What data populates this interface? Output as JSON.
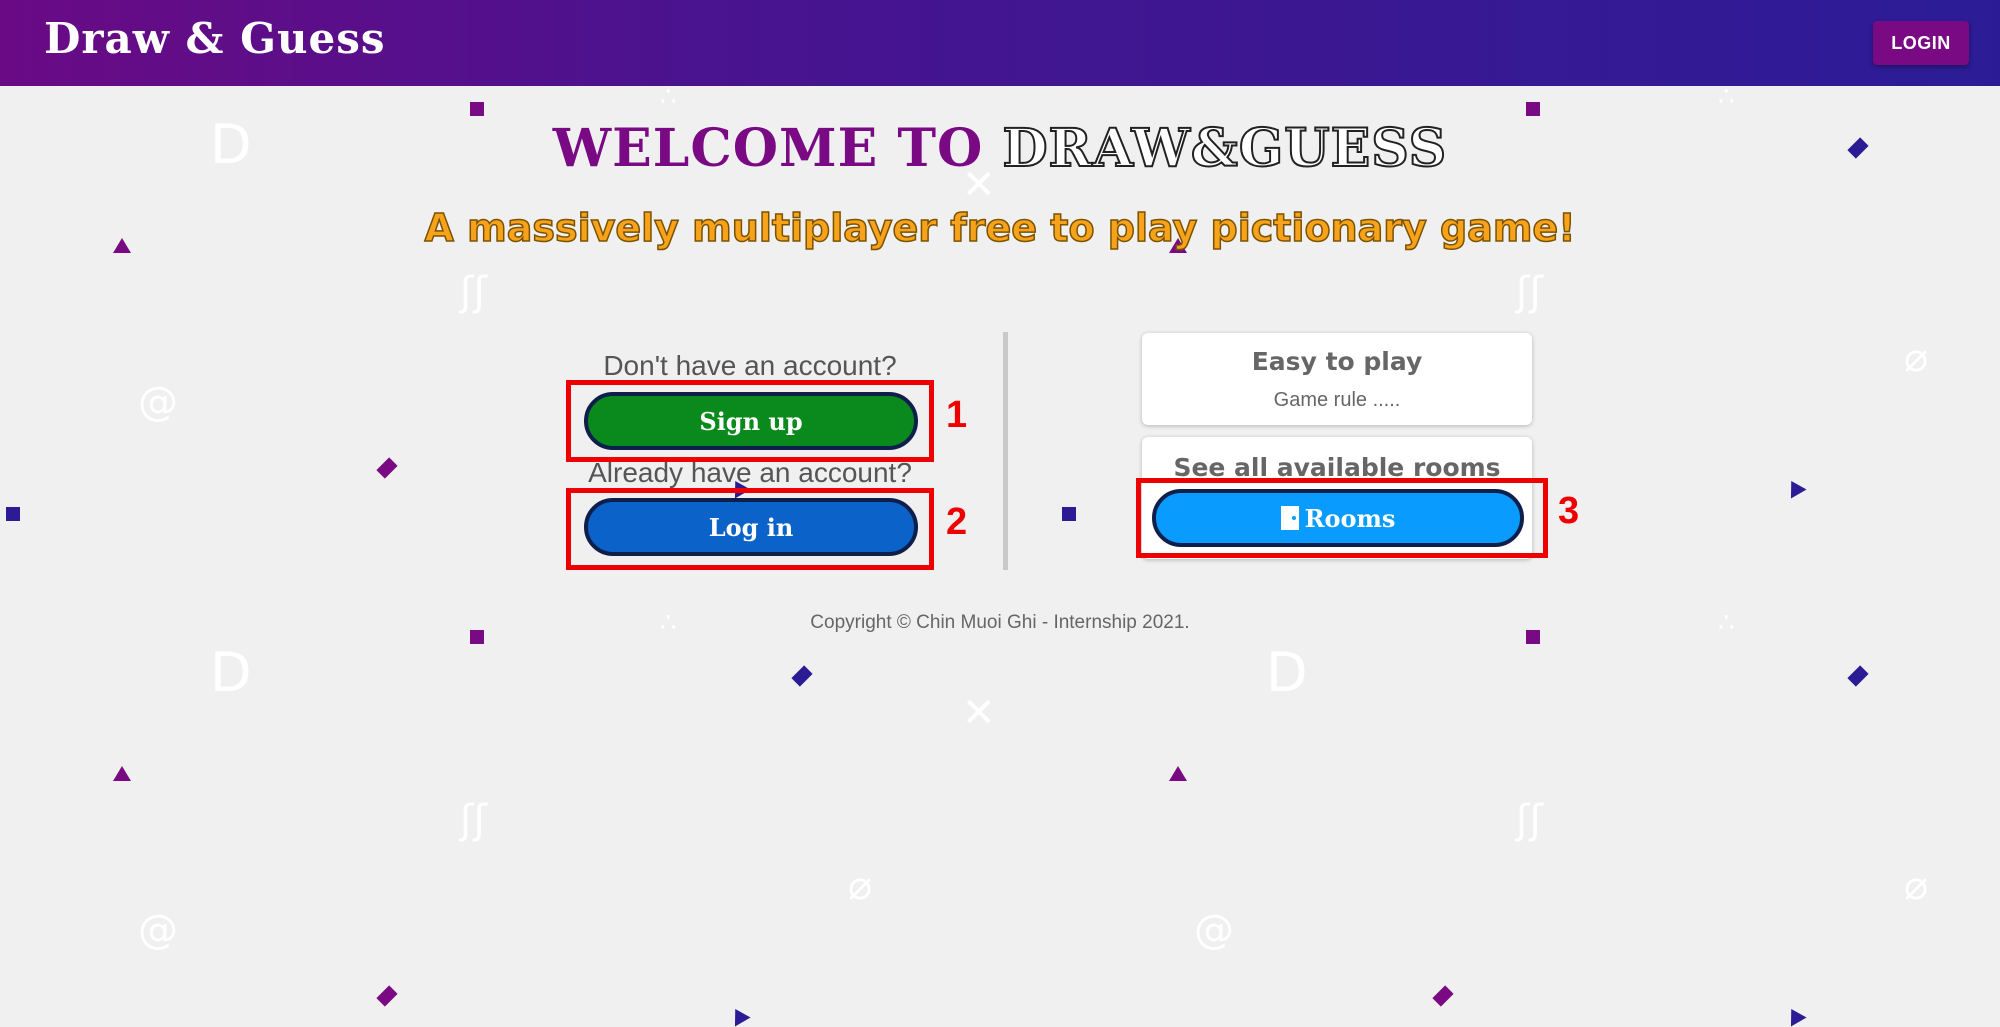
{
  "header": {
    "brand": "Draw & Guess",
    "login_label": "LOGIN"
  },
  "hero": {
    "welcome_part1": "WELCOME TO ",
    "welcome_part2": "DRAW&GUESS",
    "tagline": "A massively multiplayer free to play pictionary game!"
  },
  "auth": {
    "signup_prompt": "Don't have an account?",
    "signup_label": "Sign up",
    "login_prompt": "Already have an account?",
    "login_label": "Log in"
  },
  "cards": {
    "rules_title": "Easy to play",
    "rules_text": "Game rule .....",
    "rooms_title": "See all available rooms",
    "rooms_label": "Rooms",
    "rooms_icon": "door-icon"
  },
  "annotations": [
    "1",
    "2",
    "3"
  ],
  "footer": {
    "copyright": "Copyright © Chin Muoi Ghi - Internship 2021."
  },
  "colors": {
    "header_start": "#6a0a85",
    "header_end": "#2b1c96",
    "signup": "#0a8a1c",
    "login": "#0b62c9",
    "rooms": "#0a9bff",
    "tagline": "#f7a21b",
    "annotation": "#ee0000"
  }
}
